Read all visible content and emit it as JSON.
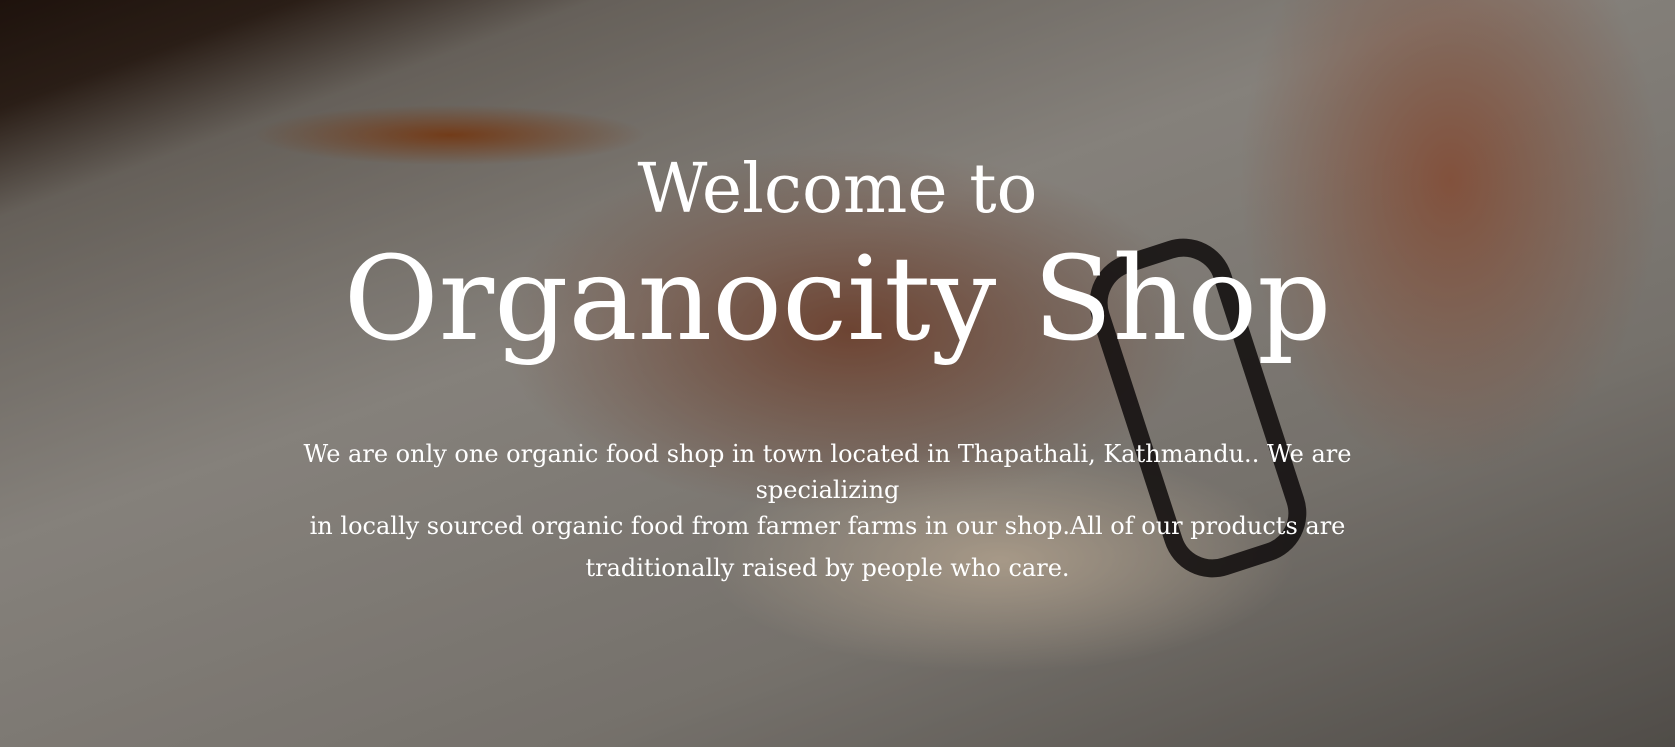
{
  "hero": {
    "welcome": "Welcome to",
    "title": "Organocity Shop",
    "description_lines": [
      "We are  only one organic food shop in town located in Thapathali, Kathmandu.. We are specializing",
      "in locally sourced organic food from farmer farms in our shop.All of  our products are",
      "traditionally raised by people who care."
    ]
  }
}
